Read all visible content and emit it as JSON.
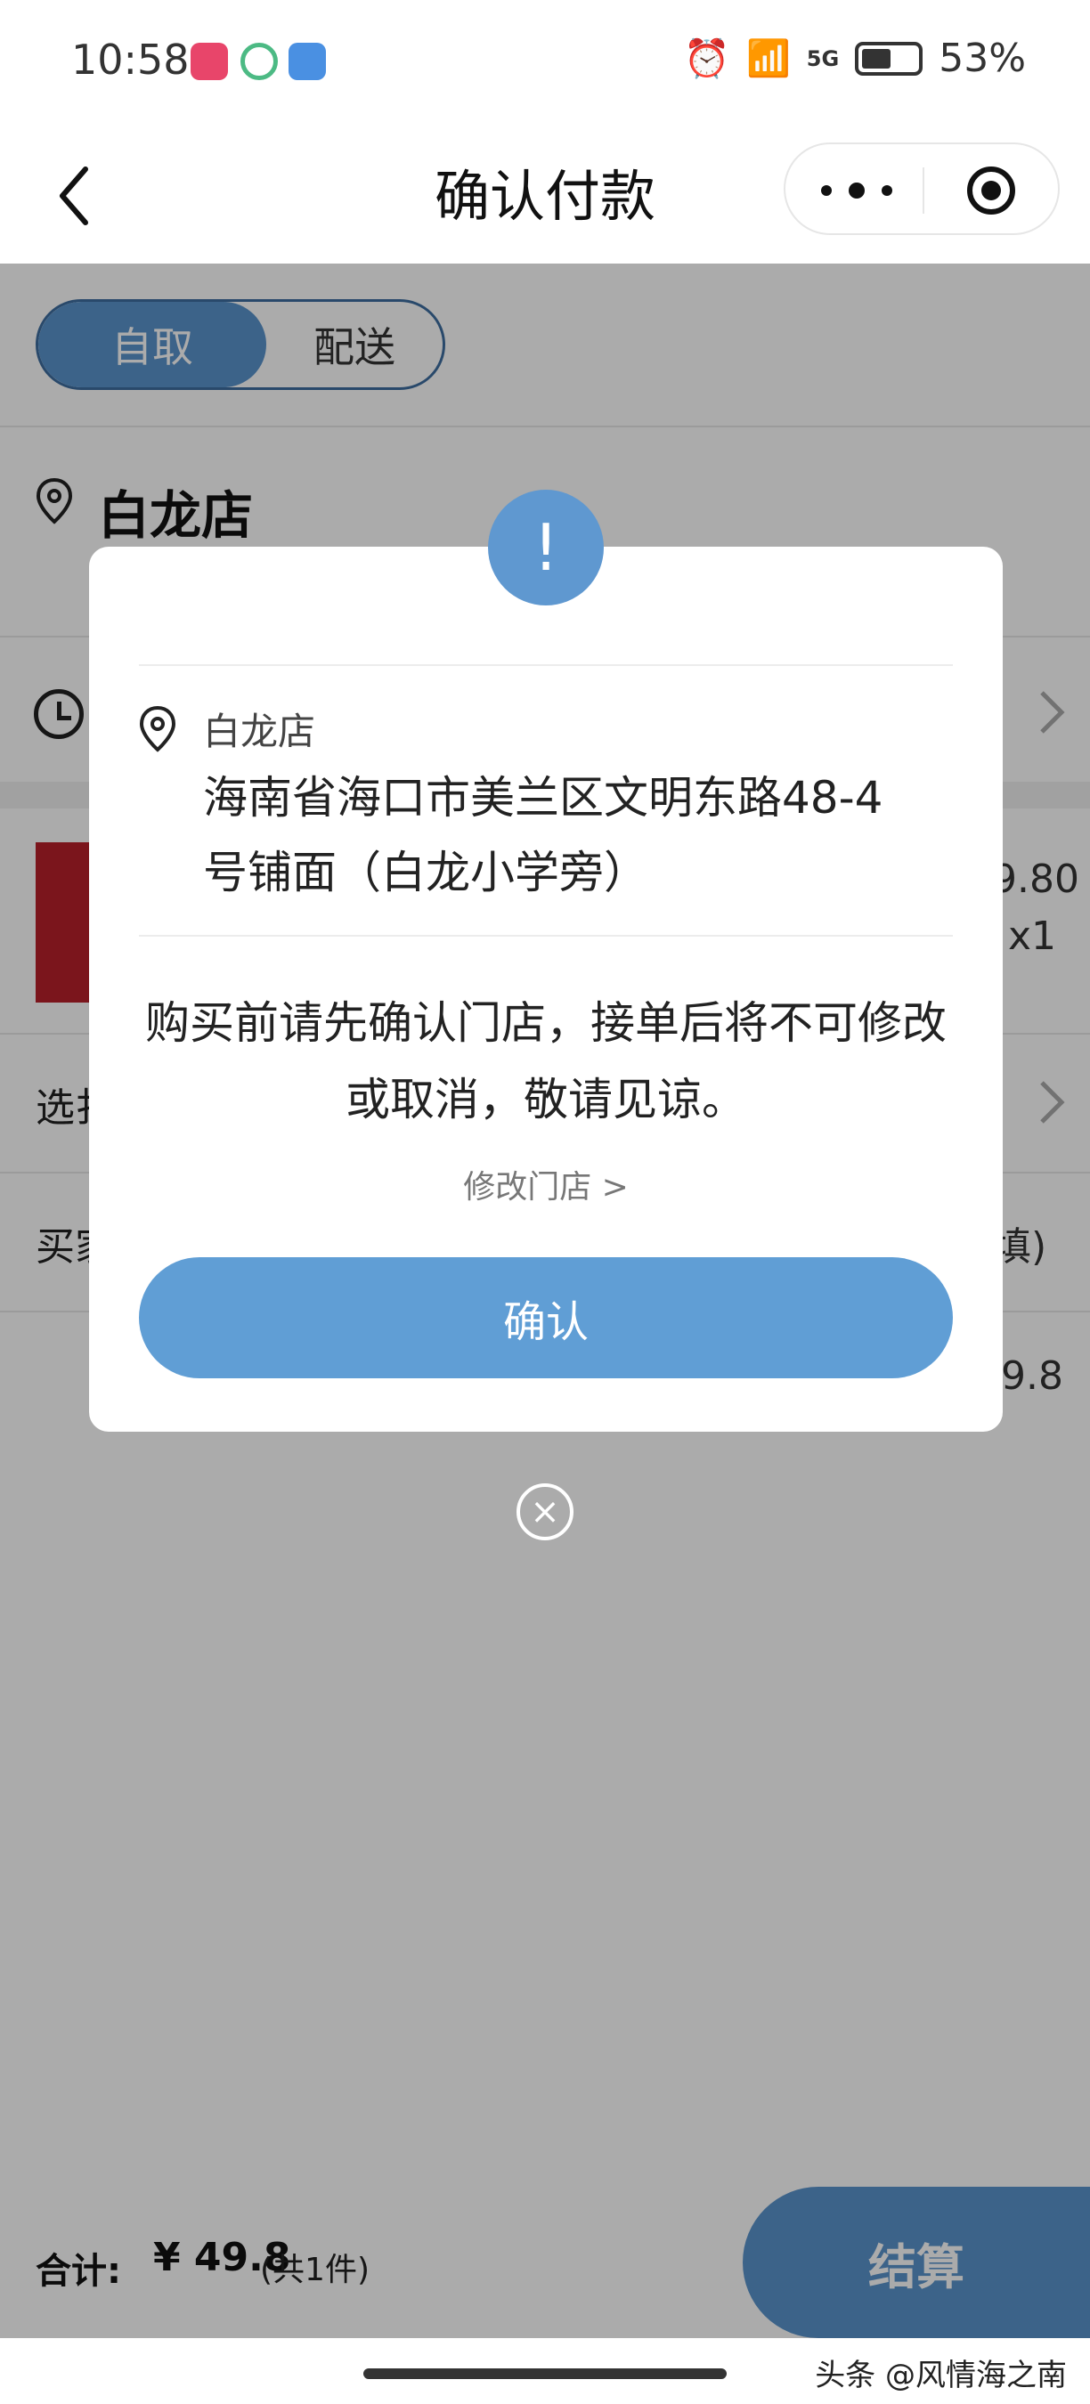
{
  "status_bar": {
    "time": "10:58",
    "battery_percent": "53%",
    "battery_level": 0.53,
    "network": "5G"
  },
  "nav": {
    "title": "确认付款",
    "more_icon": "more-dots-icon",
    "mini_program_icon": "target-icon"
  },
  "delivery_toggle": {
    "options": [
      "自取",
      "配送"
    ],
    "selected": "自取"
  },
  "store": {
    "name": "白龙店"
  },
  "order_background": {
    "price_partial": "9.80",
    "quantity": "x1",
    "select_label_partial": "选扌",
    "buyer_label_partial": "买家",
    "required_partial": "填)",
    "subtotal_partial": "9.8"
  },
  "modal": {
    "alert_symbol": "!",
    "store_name": "白龙店",
    "address": "海南省海口市美兰区文明东路48-4号铺面（白龙小学旁）",
    "notice": "购买前请先确认门店，接单后将不可修改或取消，敬请见谅。",
    "change_store": "修改门店 >",
    "confirm": "确认",
    "close_symbol": "×"
  },
  "bottom_bar": {
    "total_label": "合计:",
    "total_value": "¥ 49.8",
    "total_count": "(共1件)",
    "checkout": "结算"
  },
  "watermark": "头条 @风情海之南",
  "colors": {
    "accent": "#5f98d0",
    "overlay": "rgba(0,0,0,0.33)"
  }
}
